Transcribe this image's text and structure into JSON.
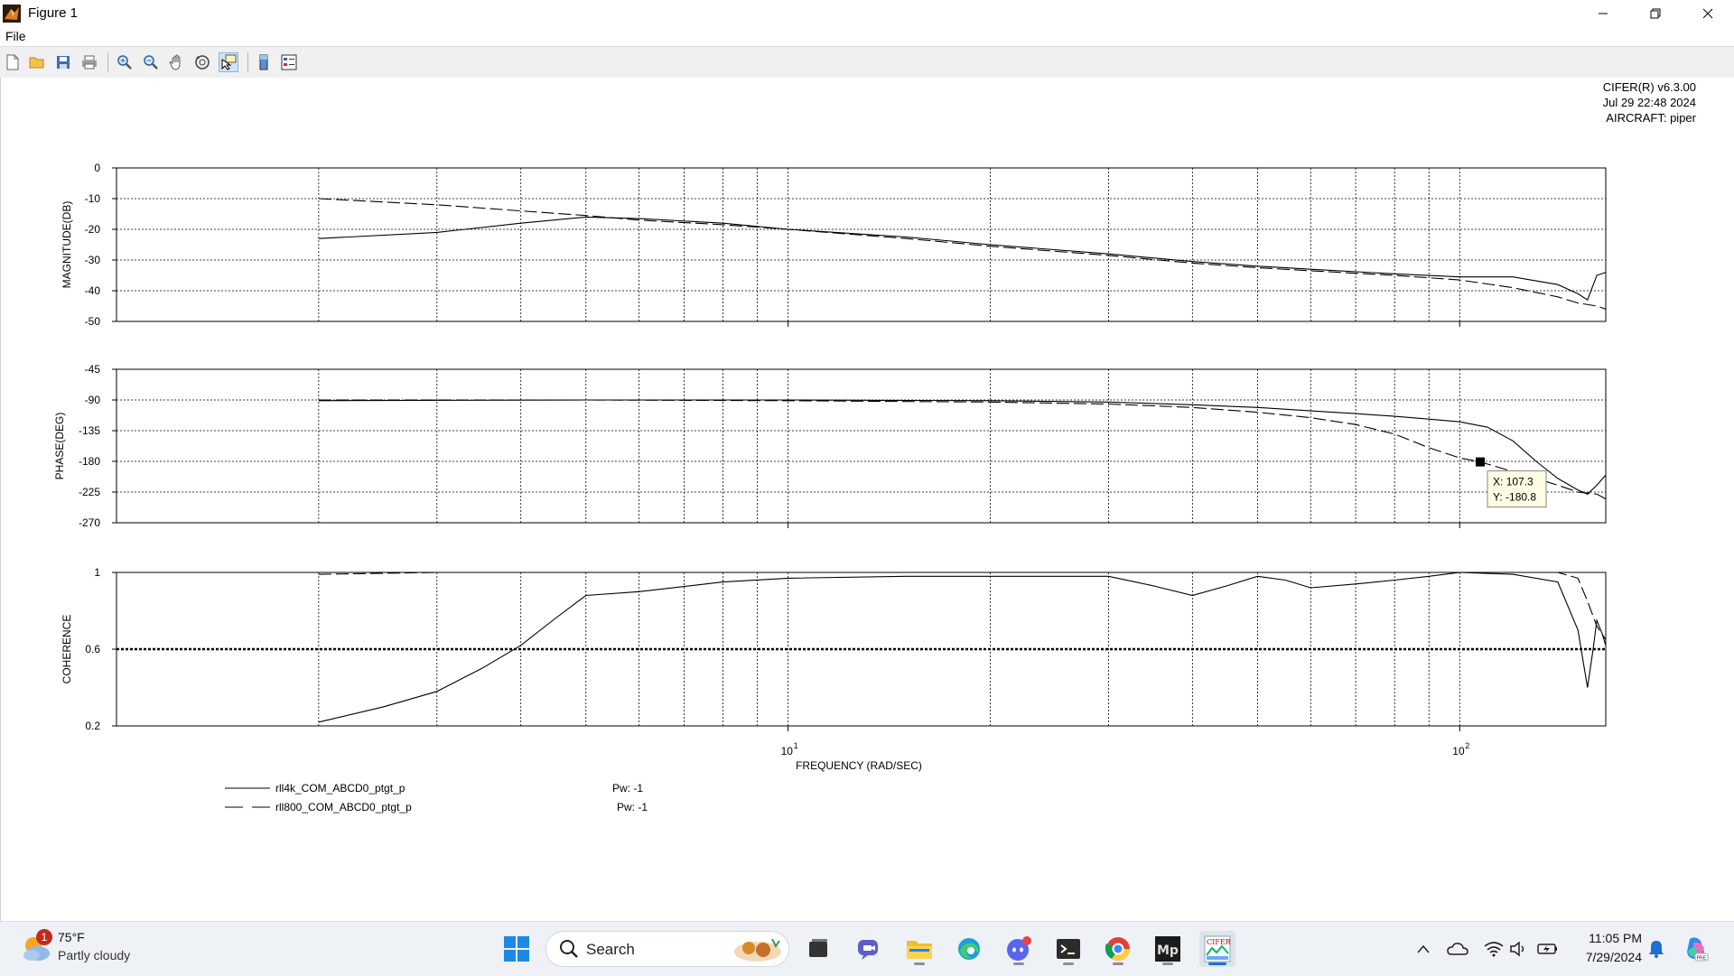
{
  "window": {
    "title": "Figure 1"
  },
  "menu": {
    "file": "File"
  },
  "toolbar": {
    "icons": [
      "new-figure",
      "open-file",
      "save",
      "print",
      "zoom-in",
      "zoom-out",
      "pan",
      "rotate",
      "data-cursor",
      "colorbar",
      "legend"
    ]
  },
  "stamp": {
    "line1": "CIFER(R) v6.3.00",
    "line2": "Jul 29 22:48 2024",
    "line3": "AIRCRAFT: piper"
  },
  "chart_data": [
    {
      "type": "line",
      "ylabel": "MAGNITUDE(DB)",
      "xscale": "log",
      "xlim": [
        1,
        165
      ],
      "ylim": [
        -50,
        0
      ],
      "yticks": [
        "0",
        "-10",
        "-20",
        "-30",
        "-40",
        "-50"
      ],
      "grid": true,
      "series": [
        {
          "name": "rll4k_COM_ABCD0_ptgt_p",
          "style": "solid",
          "x": [
            2,
            3,
            4,
            5,
            6,
            8,
            10,
            15,
            20,
            30,
            40,
            50,
            60,
            80,
            100,
            120,
            140,
            150,
            155,
            160,
            165
          ],
          "y": [
            -23,
            -21,
            -18,
            -16,
            -16.5,
            -18,
            -20,
            -22.5,
            -25,
            -28,
            -30.5,
            -32,
            -33,
            -34.5,
            -35.5,
            -35.5,
            -38,
            -41,
            -43,
            -35,
            -34
          ]
        },
        {
          "name": "rll800_COM_ABCD0_ptgt_p",
          "style": "dashed",
          "x": [
            2,
            3,
            4,
            5,
            6,
            8,
            10,
            15,
            20,
            30,
            40,
            50,
            60,
            80,
            100,
            120,
            140,
            150,
            160,
            165
          ],
          "y": [
            -10,
            -12,
            -14,
            -15.5,
            -17,
            -18.5,
            -20,
            -23,
            -25.5,
            -28.5,
            -31,
            -32.5,
            -33.5,
            -35,
            -36.5,
            -39,
            -42,
            -44,
            -45,
            -46
          ]
        }
      ]
    },
    {
      "type": "line",
      "ylabel": "PHASE(DEG)",
      "xscale": "log",
      "xlim": [
        1,
        165
      ],
      "ylim": [
        -270,
        -45
      ],
      "yticks": [
        "-45",
        "-90",
        "-135",
        "-180",
        "-225",
        "-270"
      ],
      "grid": true,
      "series": [
        {
          "name": "rll4k_COM_ABCD0_ptgt_p",
          "style": "solid",
          "x": [
            2,
            5,
            10,
            20,
            30,
            40,
            50,
            60,
            70,
            80,
            90,
            100,
            110,
            120,
            130,
            140,
            150,
            155,
            160,
            165
          ],
          "y": [
            -91,
            -90,
            -90,
            -91,
            -93,
            -97,
            -101,
            -106,
            -110,
            -114,
            -118,
            -122,
            -130,
            -150,
            -180,
            -205,
            -222,
            -228,
            -215,
            -200
          ]
        },
        {
          "name": "rll800_COM_ABCD0_ptgt_p",
          "style": "dashed",
          "x": [
            2,
            5,
            10,
            20,
            30,
            40,
            50,
            60,
            70,
            80,
            90,
            100,
            107.3,
            120,
            130,
            140,
            150,
            160,
            165
          ],
          "y": [
            -90,
            -90,
            -91,
            -93,
            -96,
            -101,
            -108,
            -116,
            -126,
            -140,
            -160,
            -175,
            -180.8,
            -195,
            -205,
            -215,
            -225,
            -228,
            -235
          ]
        }
      ],
      "datatip": {
        "x_label": "X: 107.3",
        "y_label": "Y: -180.8",
        "x": 107.3,
        "y": -180.8
      }
    },
    {
      "type": "line",
      "ylabel": "COHERENCE",
      "xlabel": "FREQUENCY (RAD/SEC)",
      "xscale": "log",
      "xlim": [
        1,
        165
      ],
      "ylim": [
        0.2,
        1
      ],
      "yticks": [
        "1",
        "0.6",
        "0.2"
      ],
      "xticks": [
        {
          "base": "10",
          "exp": "1",
          "value": 10
        },
        {
          "base": "10",
          "exp": "2",
          "value": 100
        }
      ],
      "grid": true,
      "series": [
        {
          "name": "rll4k_COM_ABCD0_ptgt_p",
          "style": "solid",
          "x": [
            2,
            2.5,
            3,
            3.5,
            4,
            4.5,
            5,
            6,
            8,
            10,
            15,
            20,
            30,
            35,
            40,
            45,
            50,
            55,
            60,
            70,
            80,
            90,
            100,
            120,
            140,
            150,
            155,
            158,
            160,
            163,
            165
          ],
          "y": [
            0.22,
            0.3,
            0.38,
            0.5,
            0.62,
            0.76,
            0.88,
            0.9,
            0.95,
            0.97,
            0.98,
            0.98,
            0.98,
            0.93,
            0.88,
            0.93,
            0.98,
            0.96,
            0.92,
            0.94,
            0.96,
            0.98,
            1.0,
            0.99,
            0.95,
            0.7,
            0.4,
            0.6,
            0.75,
            0.68,
            0.62
          ]
        },
        {
          "name": "rll800_COM_ABCD0_ptgt_p",
          "style": "dashed",
          "x": [
            2,
            3,
            5,
            10,
            20,
            50,
            100,
            140,
            150,
            155,
            160,
            165
          ],
          "y": [
            0.99,
            1.0,
            1.0,
            1.0,
            1.0,
            1.0,
            1.0,
            1.0,
            0.97,
            0.85,
            0.72,
            0.65
          ]
        }
      ],
      "thick_line_y": 0.6
    }
  ],
  "legend": [
    {
      "name": "rll4k_COM_ABCD0_ptgt_p",
      "pw": "Pw:  -1"
    },
    {
      "name": "rll800_COM_ABCD0_ptgt_p",
      "pw": "Pw:  -1"
    }
  ],
  "taskbar": {
    "weather_temp": "75°F",
    "weather_desc": "Partly cloudy",
    "weather_badge": "1",
    "search_label": "Search",
    "time": "11:05 PM",
    "date": "7/29/2024",
    "pinned": [
      "start",
      "file-explorer-window",
      "teams-chat",
      "file-explorer",
      "edge",
      "discord",
      "terminal",
      "chrome",
      "mplab",
      "cifer"
    ]
  }
}
